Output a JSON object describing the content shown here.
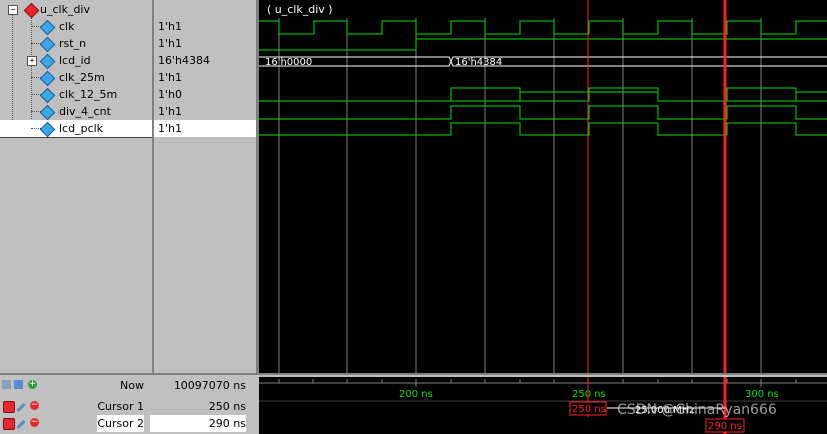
{
  "signals": [
    {
      "name": "u_clk_div",
      "value": "",
      "kind": "module"
    },
    {
      "name": "clk",
      "value": "1'h1",
      "kind": "signal"
    },
    {
      "name": "rst_n",
      "value": "1'h1",
      "kind": "signal"
    },
    {
      "name": "lcd_id",
      "value": "16'h4384",
      "kind": "bus"
    },
    {
      "name": "clk_25m",
      "value": "1'h1",
      "kind": "signal"
    },
    {
      "name": "clk_12_5m",
      "value": "1'h0",
      "kind": "signal"
    },
    {
      "name": "div_4_cnt",
      "value": "1'h1",
      "kind": "signal"
    },
    {
      "name": "lcd_pclk",
      "value": "1'h1",
      "kind": "signal",
      "selected": true
    }
  ],
  "wave_header": "( u_clk_div )",
  "bus_values": [
    "16'h0000",
    "16'h4384"
  ],
  "status": {
    "now_label": "Now",
    "now_value": "10097070 ns",
    "cursor1_label": "Cursor 1",
    "cursor1_value": "250 ns",
    "cursor2_label": "Cursor 2",
    "cursor2_value": "290 ns"
  },
  "timeline": {
    "ticks": [
      "200 ns",
      "250 ns",
      "300 ns"
    ],
    "cursor1_tag": "250 ns",
    "cursor2_tag": "290 ns",
    "freq_label": "25.000 MHz"
  },
  "watermark": "CSDN @ChinaRyan666",
  "colors": {
    "wave": "#00e000",
    "cursor": "#ff2020",
    "selected_wave": "#ffff00",
    "grid": "#808080"
  },
  "icons": {
    "module": "red-diamond-icon",
    "signal": "blue-diamond-icon",
    "expand": "expand-plus-icon",
    "lock": "lock-icon",
    "wrench": "wrench-icon",
    "delete": "minus-circle-icon",
    "add": "plus-circle-icon"
  }
}
